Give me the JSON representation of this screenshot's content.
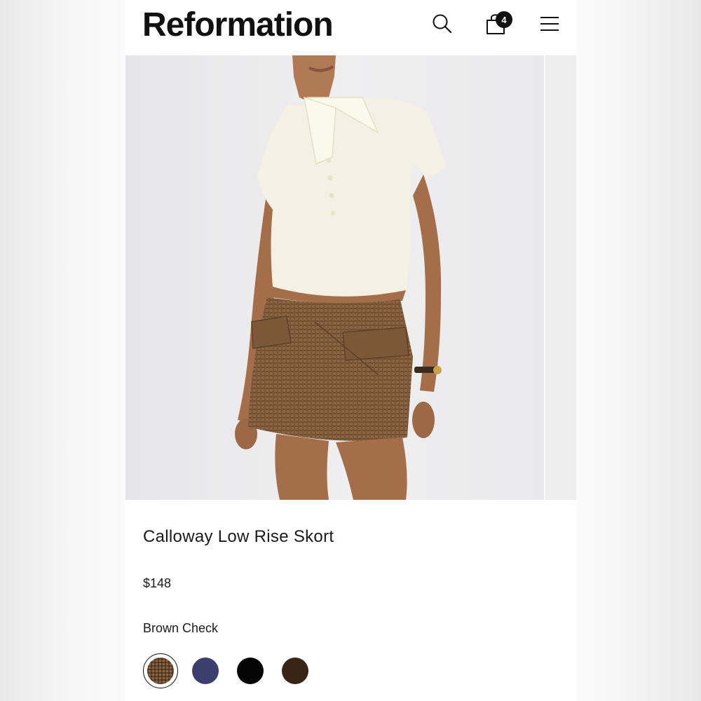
{
  "header": {
    "logo": "Reformation",
    "cart_count": "4",
    "icons": [
      "search-icon",
      "shopping-bag-icon",
      "hamburger-menu-icon"
    ]
  },
  "gallery": {
    "image_description_icon": "product-photo"
  },
  "product": {
    "name": "Calloway Low Rise Skort",
    "price": "$148",
    "selected_color": "Brown Check",
    "swatches": [
      {
        "color": "#7b5a3c",
        "selected": true,
        "pattern": "check"
      },
      {
        "color": "#3c3f6e",
        "selected": false
      },
      {
        "color": "#050505",
        "selected": false
      },
      {
        "color": "#3a2416",
        "selected": false
      }
    ]
  }
}
